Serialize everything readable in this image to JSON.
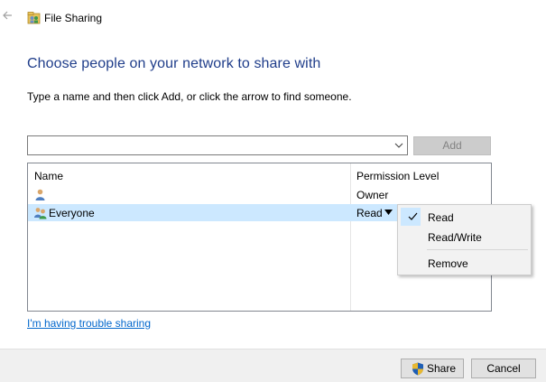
{
  "window": {
    "title": "File Sharing",
    "back_icon": "back-arrow-icon",
    "title_icon": "file-sharing-icon"
  },
  "main": {
    "heading": "Choose people on your network to share with",
    "instruction": "Type a name and then click Add, or click the arrow to find someone.",
    "name_input": {
      "value": "",
      "placeholder": ""
    },
    "add_label": "Add"
  },
  "table": {
    "columns": [
      "Name",
      "Permission Level"
    ],
    "rows": [
      {
        "name": "",
        "permission": "Owner",
        "icon": "user-icon"
      },
      {
        "name": "Everyone",
        "permission": "Read",
        "icon": "users-group-icon",
        "selected": true
      }
    ]
  },
  "menu": {
    "items": [
      {
        "label": "Read",
        "checked": true
      },
      {
        "label": "Read/Write",
        "checked": false
      },
      {
        "label": "Remove",
        "checked": false
      }
    ]
  },
  "trouble_link": "I'm having trouble sharing",
  "footer": {
    "share_label": "Share",
    "cancel_label": "Cancel"
  },
  "colors": {
    "heading": "#1f3d8a",
    "selection": "#cce8ff",
    "link": "#0066cc",
    "footer_bg": "#f0f0f0"
  }
}
